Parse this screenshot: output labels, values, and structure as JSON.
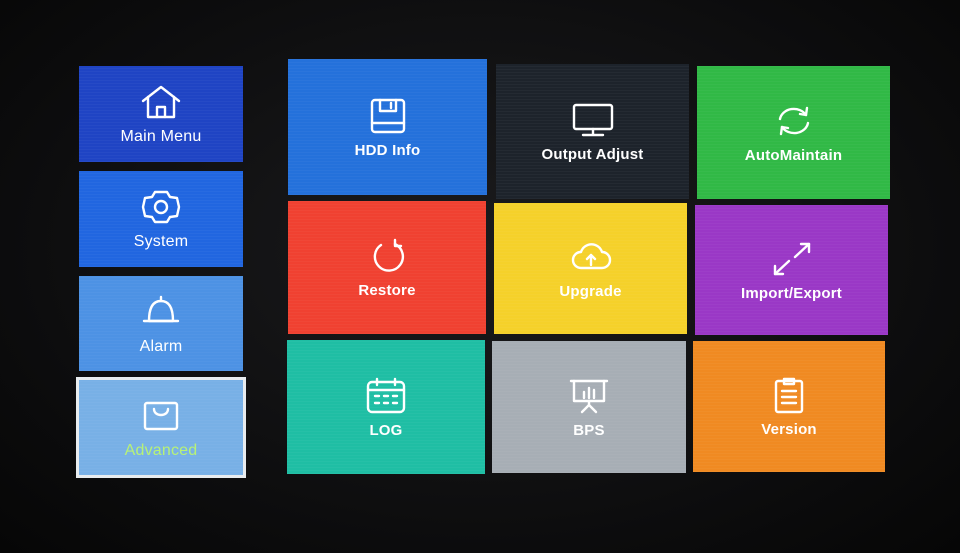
{
  "sidebar": {
    "items": [
      {
        "label": "Main Menu",
        "icon": "home-icon",
        "color": "#1f44c4"
      },
      {
        "label": "System",
        "icon": "gear-icon",
        "color": "#2166e0"
      },
      {
        "label": "Alarm",
        "icon": "bell-icon",
        "color": "#4d92e4"
      },
      {
        "label": "Advanced",
        "icon": "bag-icon",
        "color": "#78b0e6",
        "selected": true
      }
    ]
  },
  "grid": {
    "tiles": [
      {
        "label": "HDD Info",
        "icon": "disk-icon",
        "color": "#2471db"
      },
      {
        "label": "Output Adjust",
        "icon": "monitor-icon",
        "color": "#1d232b"
      },
      {
        "label": "AutoMaintain",
        "icon": "sync-icon",
        "color": "#31b946"
      },
      {
        "label": "Restore",
        "icon": "restore-icon",
        "color": "#f04131"
      },
      {
        "label": "Upgrade",
        "icon": "cloud-upload-icon",
        "color": "#f5d12a"
      },
      {
        "label": "Import/Export",
        "icon": "arrows-diagonal-icon",
        "color": "#9a38c6"
      },
      {
        "label": "LOG",
        "icon": "calendar-icon",
        "color": "#1fbea4"
      },
      {
        "label": "BPS",
        "icon": "presentation-chart-icon",
        "color": "#a7aeb5"
      },
      {
        "label": "Version",
        "icon": "clipboard-icon",
        "color": "#f08a22"
      }
    ]
  }
}
